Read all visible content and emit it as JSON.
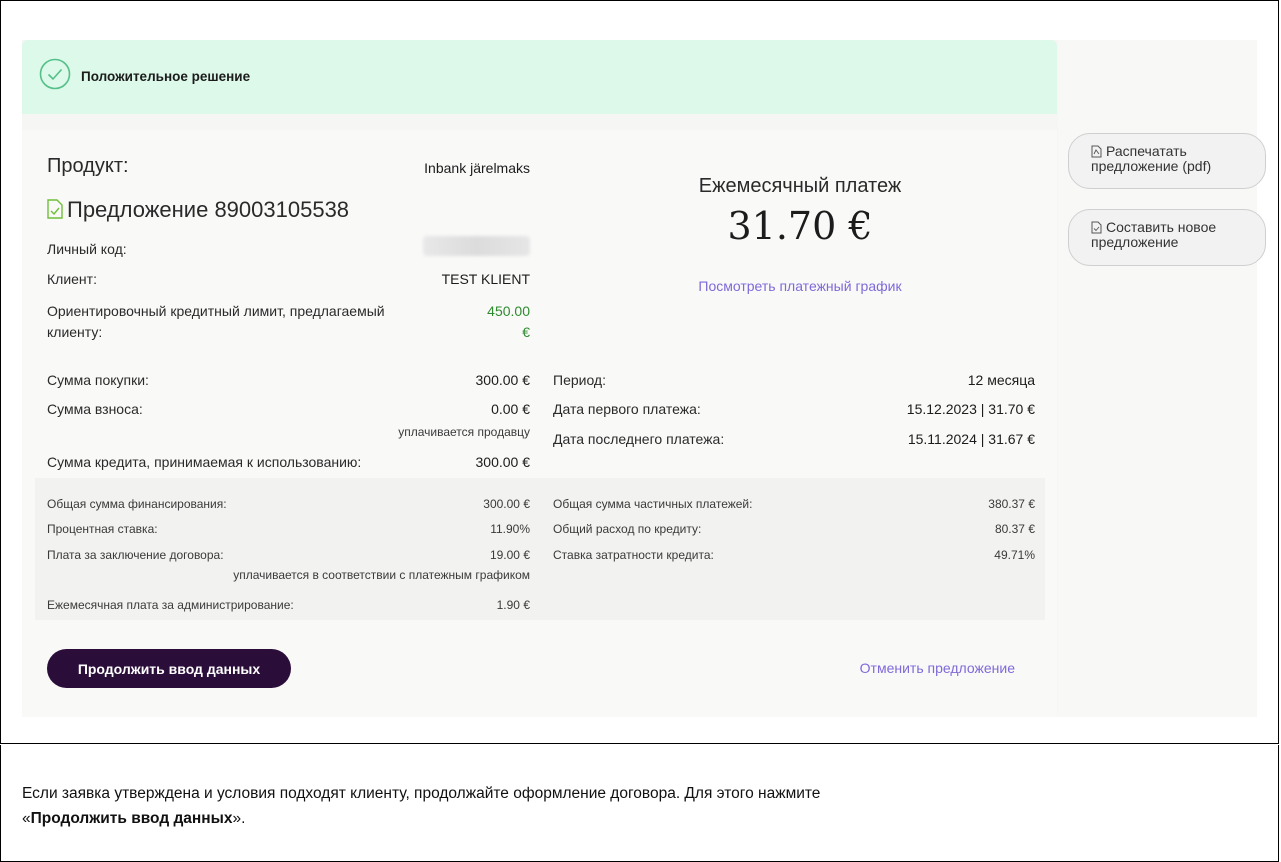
{
  "banner": {
    "text": "Положительное решение"
  },
  "offer": {
    "product_label": "Продукт:",
    "product_value": "Inbank järelmaks",
    "offer_title": "Предложение 89003105538",
    "personal_code_label": "Личный код:",
    "client_label": "Клиент:",
    "client_value": "TEST KLIENT",
    "limit_label_line1": "Ориентировочный кредитный лимит, предлагаемый",
    "limit_label_line2": "клиенту:",
    "limit_value_line1": "450.00",
    "limit_value_line2": "€",
    "purchase_label": "Сумма покупки:",
    "purchase_value": "300.00 €",
    "deposit_label": "Сумма взноса:",
    "deposit_value": "0.00 €",
    "deposit_note": "уплачивается продавцу",
    "credit_label": "Сумма кредита, принимаемая к использованию:",
    "credit_value": "300.00 €",
    "monthly_title": "Ежемесячный платеж",
    "monthly_amount": "31.70 €",
    "schedule_link": "Посмотреть платежный график",
    "period_label": "Период:",
    "period_value": "12 месяца",
    "first_payment_label": "Дата первого платежа:",
    "first_payment_value": "15.12.2023 | 31.70 €",
    "last_payment_label": "Дата последнего платежа:",
    "last_payment_value": "15.11.2024 | 31.67 €"
  },
  "details": {
    "left": [
      {
        "label": "Общая сумма финансирования:",
        "value": "300.00 €"
      },
      {
        "label": "Процентная ставка:",
        "value": "11.90%"
      },
      {
        "label": "Плата за заключение договора:",
        "value": "19.00 €"
      },
      {
        "label": "Ежемесячная плата за администрирование:",
        "value": "1.90 €"
      }
    ],
    "fee_note": "уплачивается в соответствии с платежным графиком",
    "right": [
      {
        "label": "Общая сумма частичных платежей:",
        "value": "380.37 €"
      },
      {
        "label": "Общий расход по кредиту:",
        "value": "80.37 €"
      },
      {
        "label": "Ставка затратности кредита:",
        "value": "49.71%"
      }
    ]
  },
  "actions": {
    "continue": "Продолжить ввод данных",
    "cancel": "Отменить предложение",
    "print_line1": "Распечатать",
    "print_line2": "предложение (pdf)",
    "new_line1": "Составить новое",
    "new_line2": "предложение"
  },
  "caption": {
    "line1": "Если заявка утверждена и условия подходят клиенту, продолжайте оформление договора. Для этого нажмите",
    "open_quote": "«",
    "bold": "Продолжить ввод данных",
    "close": "»."
  },
  "colors": {
    "accent": "#8069d8",
    "primary": "#2b0d3a",
    "success_bg": "#dcf9ea",
    "green_value": "#2f8a2f"
  }
}
